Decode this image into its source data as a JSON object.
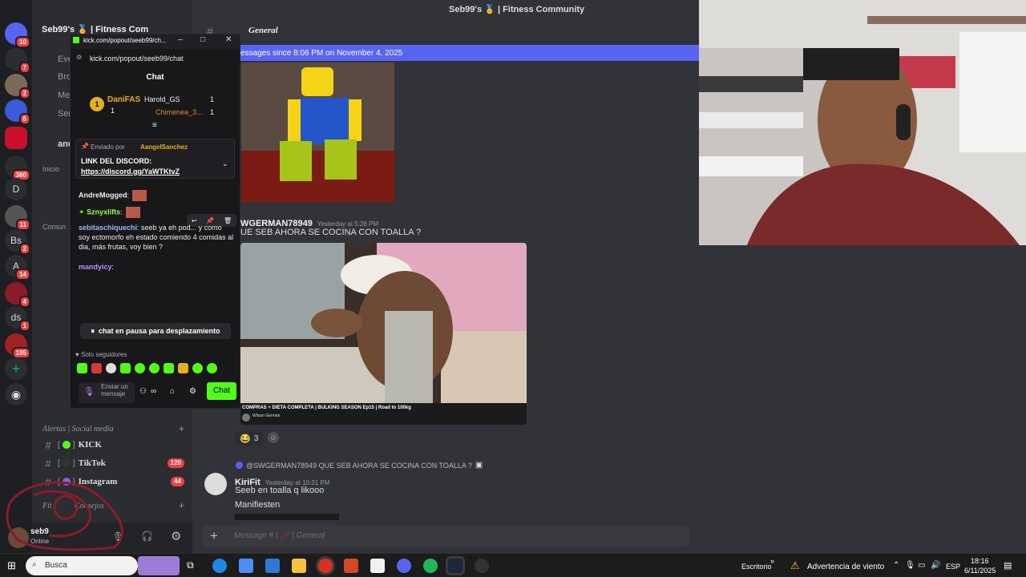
{
  "window": {
    "title": "Seb99's 🏅 | Fitness Community",
    "server_name": "Seb99's 🏅 | Fitness Com",
    "channel_header": "General"
  },
  "rail": [
    {
      "label": "",
      "badge": "10"
    },
    {
      "label": "",
      "badge": "7"
    },
    {
      "label": "",
      "badge": "2"
    },
    {
      "label": "",
      "badge": "6"
    },
    {
      "label": "",
      "badge": ""
    },
    {
      "label": "",
      "badge": "360"
    },
    {
      "label": "D",
      "badge": ""
    },
    {
      "label": "",
      "badge": "11"
    },
    {
      "label": "Bs",
      "badge": "2"
    },
    {
      "label": "A",
      "badge": "14"
    },
    {
      "label": "",
      "badge": "4"
    },
    {
      "label": "ds",
      "badge": "1"
    },
    {
      "label": "",
      "badge": "195"
    }
  ],
  "sidebar": {
    "top_items": [
      "Eve",
      "Bro",
      "Me",
      "Ser",
      "anu"
    ],
    "inicio": "Inicio",
    "comun": "Comun",
    "alertas_category": "Alertas | Social media",
    "channels": [
      {
        "name": "KICK",
        "count": ""
      },
      {
        "name": "TikTok",
        "count": "120"
      },
      {
        "name": "Instagram",
        "count": "44"
      }
    ],
    "fit_category": "Fit",
    "fit_sub": "Consejos",
    "user_name": "seb9",
    "user_status": "Online"
  },
  "kick": {
    "window_title": "kick.com/popout/seeb99/ch...",
    "url": "kick.com/popout/seeb99/chat",
    "header": "Chat",
    "leaderboard": [
      {
        "name": "DaniFAS",
        "value": "1"
      },
      {
        "name": "Harold_GS",
        "value": "1"
      },
      {
        "name": "Chimenea_3...",
        "value": "1"
      }
    ],
    "pinned_by_label": "Enviado por",
    "pinned_by": "AangelSanchez",
    "pinned_title": "LINK DEL DISCORD:",
    "pinned_link": "https://discord.gg/YaWTKtvZ",
    "messages": [
      {
        "user": "AndreMogged",
        "text": ""
      },
      {
        "user": "Sznyxlifts",
        "text": ""
      },
      {
        "user": "sebitaschiquechi",
        "text": "seeb ya eh pod... y como soy ectomorfo eh estado comiendo 4 comidas al dia, más frutas, voy bien ?"
      },
      {
        "user": "mandyicy",
        "text": ""
      }
    ],
    "paused": "chat en pausa para desplazamiento",
    "followers_only": "Solo seguidores",
    "input_placeholder": "Enviar un mensaje",
    "send_button": "Chat"
  },
  "chat": {
    "new_messages_bar": "essages since 8:06 PM on November 4, 2025",
    "message1": {
      "author": "WGERMAN78949",
      "time": "Yesterday at 5:28 PM",
      "text": "UE SEB AHORA SE COCINA CON TOALLA ?"
    },
    "video_caption": "COMPRAS + DIETA COMPLETA | BULKING SEASON Ep15 | Road to 100kg",
    "video_channel": "Wilson Germán",
    "reaction_count": "3",
    "reply_preview": "@SWGERMAN78949 QUE SEB AHORA SE COCINA CON TOALLA ?",
    "message2": {
      "author": "KiriFit",
      "time": "Yesterday at 10:31 PM",
      "lines": [
        "Seeb en toalla q likooo",
        "Manifiesten"
      ]
    },
    "input_placeholder": "Message # | 🥢 | General"
  },
  "taskbar": {
    "search": "Busca",
    "desktop": "Escritorio",
    "weather": "Advertencia de viento",
    "lang": "ESP",
    "time": "18:16",
    "date": "6/11/2025"
  },
  "colors": {
    "discord_bg": "#313338",
    "sidebar_bg": "#2b2d31",
    "rail_bg": "#1e1f22",
    "blurple": "#5865f2",
    "kick_green": "#53fc18",
    "badge_red": "#f23f43"
  }
}
